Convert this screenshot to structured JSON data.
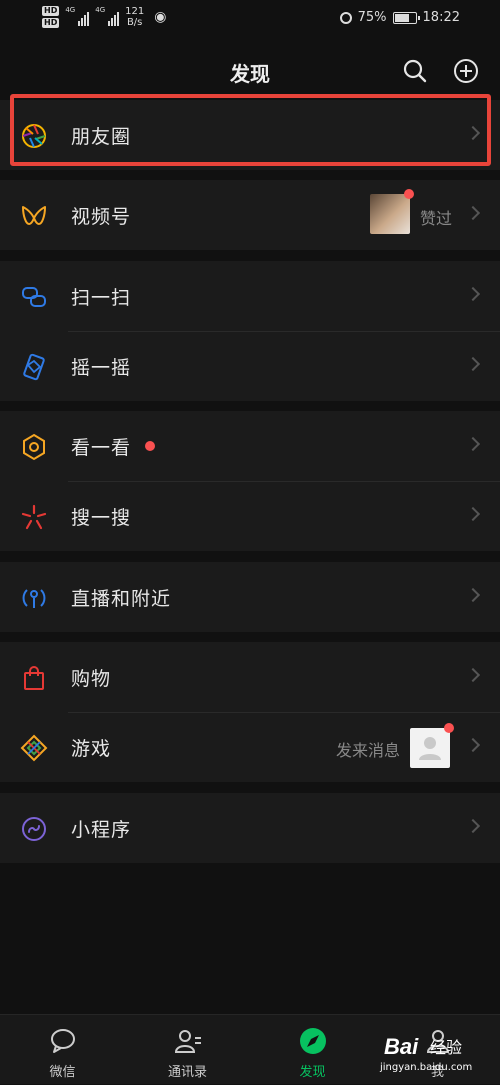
{
  "status_bar": {
    "hd_labels": [
      "HD",
      "HD"
    ],
    "network_labels": [
      "4G",
      "4G"
    ],
    "speed_value": "121",
    "speed_unit": "B/s",
    "battery_percent": "75%",
    "battery_level": 0.75,
    "time": "18:22"
  },
  "header": {
    "title": "发现",
    "search_icon": "search-icon",
    "add_icon": "plus-circle-icon"
  },
  "sections": [
    {
      "items": [
        {
          "label": "朋友圈",
          "icon": "moments-aperture-icon"
        }
      ]
    },
    {
      "items": [
        {
          "label": "视频号",
          "icon": "channels-butterfly-icon",
          "aux_text": "赞过"
        }
      ]
    },
    {
      "items": [
        {
          "label": "扫一扫",
          "icon": "scan-icon"
        },
        {
          "label": "摇一摇",
          "icon": "shake-icon"
        }
      ]
    },
    {
      "items": [
        {
          "label": "看一看",
          "icon": "top-stories-icon"
        },
        {
          "label": "搜一搜",
          "icon": "search-star-icon"
        }
      ]
    },
    {
      "items": [
        {
          "label": "直播和附近",
          "icon": "live-nearby-icon"
        }
      ]
    },
    {
      "items": [
        {
          "label": "购物",
          "icon": "shopping-bag-icon"
        },
        {
          "label": "游戏",
          "icon": "games-icon",
          "aux_text": "发来消息"
        }
      ]
    },
    {
      "items": [
        {
          "label": "小程序",
          "icon": "mini-program-icon"
        }
      ]
    }
  ],
  "bottom_nav": [
    {
      "label": "微信",
      "icon": "chat-bubble-icon"
    },
    {
      "label": "通讯录",
      "icon": "contacts-icon"
    },
    {
      "label": "发现",
      "icon": "compass-icon",
      "active": true
    },
    {
      "label": "我",
      "icon": "person-icon"
    }
  ],
  "watermark": {
    "brand": "Bai",
    "sub": "经验",
    "url": "jingyan.baidu.com"
  },
  "colors": {
    "accent": "#07c160",
    "badge": "#fa5151",
    "highlight": "#e8443a"
  }
}
